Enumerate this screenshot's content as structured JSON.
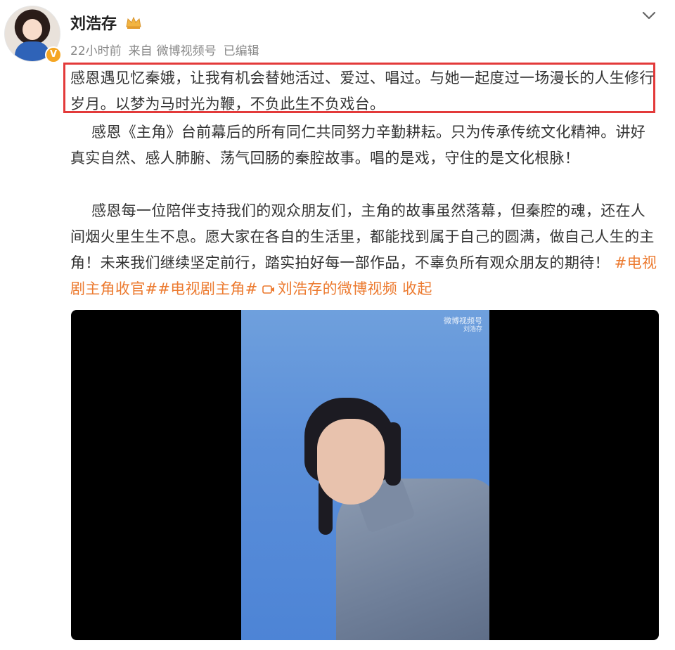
{
  "post": {
    "username": "刘浩存",
    "time": "22小时前",
    "source_prefix": "来自",
    "source": "微博视频号",
    "edited": "已编辑"
  },
  "content": {
    "p1": "感恩遇见忆秦娥，让我有机会替她活过、爱过、唱过。与她一起度过一场漫长的人生修行岁月。以梦为马时光为鞭，不负此生不负戏台。",
    "p2": "感恩《主角》台前幕后的所有同仁共同努力辛勤耕耘。只为传承传统文化精神。讲好真实自然、感人肺腑、荡气回肠的秦腔故事。唱的是戏，守住的是文化根脉！",
    "p3": "感恩每一位陪伴支持我们的观众朋友们，主角的故事虽然落幕，但秦腔的魂，还在人间烟火里生生不息。愿大家在各自的生活里，都能找到属于自己的圆满，做自己人生的主角！未来我们继续坚定前行，踏实拍好每一部作品，不辜负所有观众朋友的期待！",
    "tag1": "#电视剧主角收官#",
    "tag2": "#电视剧主角#",
    "video_link": "刘浩存的微博视频",
    "collapse": "收起"
  },
  "video": {
    "watermark_line1": "微博视频号",
    "watermark_line2": "刘浩存"
  },
  "icons": {
    "verified": "verified-badge-icon",
    "crown": "crown-icon",
    "chevron": "chevron-down-icon",
    "video": "video-icon"
  },
  "colors": {
    "highlight_border": "#e33a3a",
    "link_orange": "#ec7a2f",
    "meta_gray": "#888888"
  }
}
